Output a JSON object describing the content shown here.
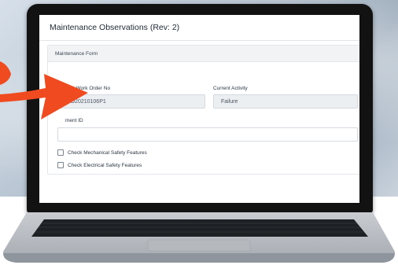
{
  "window": {
    "title": "Maintenance Observations (Rev: 2)"
  },
  "form": {
    "header": "Maintenance Form",
    "work_order_label": "Current Work Order No",
    "work_order_value": "WO20210106P1",
    "activity_label": "Current Activity",
    "activity_value": "Failure",
    "equipment_label": "ment ID",
    "equipment_value": "",
    "checks": [
      {
        "label": "Check Mechanical Safety Features",
        "checked": false
      },
      {
        "label": "Check Electrical Safety Features",
        "checked": false
      }
    ]
  },
  "colors": {
    "accent_arrow": "#f04a20",
    "bezel": "#121212"
  },
  "icons": {
    "arrow": "orange-arrow-icon"
  }
}
